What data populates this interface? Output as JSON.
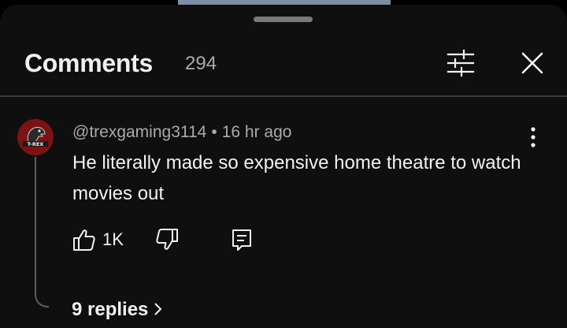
{
  "header": {
    "title": "Comments",
    "count": "294"
  },
  "comment": {
    "author": "@trexgaming3114",
    "separator": "•",
    "time": "16 hr ago",
    "text": "He literally made so expensive home theatre to watch movies out",
    "avatar_label": "T-REX",
    "likes": "1K",
    "replies_label": "9 replies"
  },
  "icons": {
    "filter": "sliders-icon",
    "close": "close-icon",
    "more": "more-vert-icon",
    "like": "thumb-up-icon",
    "dislike": "thumb-down-icon",
    "reply": "reply-comment-icon",
    "chevron": "chevron-right-icon"
  },
  "colors": {
    "background": "#0f0f0f",
    "text": "#f1f1f1",
    "secondary_text": "#aaaaaa",
    "avatar": "#7a1414"
  }
}
